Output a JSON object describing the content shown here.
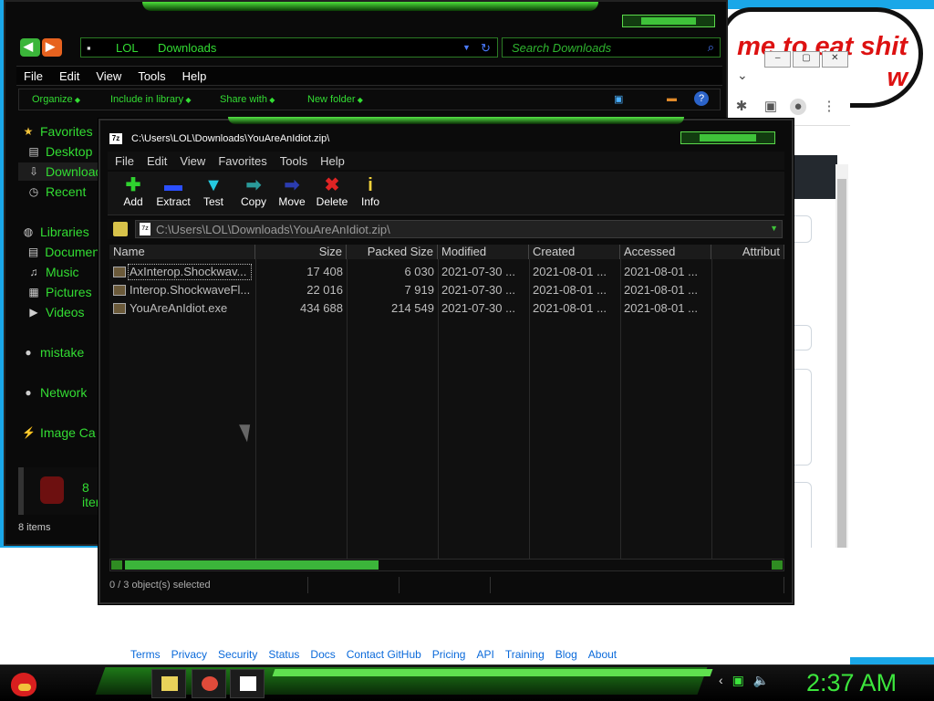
{
  "background_browser": {
    "bubble_text": "me to eat shit\nw",
    "footer_links": [
      "Terms",
      "Privacy",
      "Security",
      "Status",
      "Docs",
      "Contact GitHub",
      "Pricing",
      "API",
      "Training",
      "Blog",
      "About"
    ]
  },
  "explorer": {
    "breadcrumb": [
      "LOL",
      "Downloads"
    ],
    "search_placeholder": "Search Downloads",
    "menu": [
      "File",
      "Edit",
      "View",
      "Tools",
      "Help"
    ],
    "commands": [
      "Organize",
      "Include in library",
      "Share with",
      "New folder"
    ],
    "sidebar": [
      {
        "label": "Favorites",
        "icon": "star-icon"
      },
      {
        "label": "Desktop",
        "icon": "desktop-icon"
      },
      {
        "label": "Downloads",
        "icon": "downloads-icon"
      },
      {
        "label": "Recent",
        "icon": "recent-icon"
      },
      {
        "label": "Libraries",
        "icon": "libraries-icon"
      },
      {
        "label": "Documents",
        "icon": "documents-icon"
      },
      {
        "label": "Music",
        "icon": "music-icon"
      },
      {
        "label": "Pictures",
        "icon": "pictures-icon"
      },
      {
        "label": "Videos",
        "icon": "videos-icon"
      },
      {
        "label": "mistake",
        "icon": "computer-icon"
      },
      {
        "label": "Network",
        "icon": "network-icon"
      },
      {
        "label": "Image Ca",
        "icon": "image-capture-icon"
      }
    ],
    "details_label": "8 iten",
    "status": "8 items"
  },
  "sevenzip": {
    "title": "C:\\Users\\LOL\\Downloads\\YouAreAnIdiot.zip\\",
    "menu": [
      "File",
      "Edit",
      "View",
      "Favorites",
      "Tools",
      "Help"
    ],
    "toolbar": [
      {
        "label": "Add",
        "icon": "add-icon",
        "glyph": "✚",
        "color": "#2fd12f"
      },
      {
        "label": "Extract",
        "icon": "extract-icon",
        "glyph": "▬",
        "color": "#2b4fff"
      },
      {
        "label": "Test",
        "icon": "test-icon",
        "glyph": "▼",
        "color": "#25c9e0"
      },
      {
        "label": "Copy",
        "icon": "copy-icon",
        "glyph": "➡",
        "color": "#2a9a9a"
      },
      {
        "label": "Move",
        "icon": "move-icon",
        "glyph": "➡",
        "color": "#2b3cb0"
      },
      {
        "label": "Delete",
        "icon": "delete-icon",
        "glyph": "✖",
        "color": "#e02424"
      },
      {
        "label": "Info",
        "icon": "info-icon",
        "glyph": "i",
        "color": "#f3d23a"
      }
    ],
    "path": "C:\\Users\\LOL\\Downloads\\YouAreAnIdiot.zip\\",
    "columns": [
      "Name",
      "Size",
      "Packed Size",
      "Modified",
      "Created",
      "Accessed",
      "Attribut"
    ],
    "rows": [
      {
        "name": "AxInterop.Shockwav...",
        "size": "17 408",
        "packed": "6 030",
        "modified": "2021-07-30 ...",
        "created": "2021-08-01 ...",
        "accessed": "2021-08-01 ..."
      },
      {
        "name": "Interop.ShockwaveFl...",
        "size": "22 016",
        "packed": "7 919",
        "modified": "2021-07-30 ...",
        "created": "2021-08-01 ...",
        "accessed": "2021-08-01 ..."
      },
      {
        "name": "YouAreAnIdiot.exe",
        "size": "434 688",
        "packed": "214 549",
        "modified": "2021-07-30 ...",
        "created": "2021-08-01 ...",
        "accessed": "2021-08-01 ..."
      }
    ],
    "status": "0 / 3 object(s) selected"
  },
  "taskbar": {
    "clock": "2:37 AM",
    "apps": [
      {
        "name": "file-explorer-icon",
        "color": "#e9d25a"
      },
      {
        "name": "chrome-icon",
        "color": "#e04b3a"
      },
      {
        "name": "7zip-icon",
        "color": "#ffffff"
      }
    ]
  }
}
